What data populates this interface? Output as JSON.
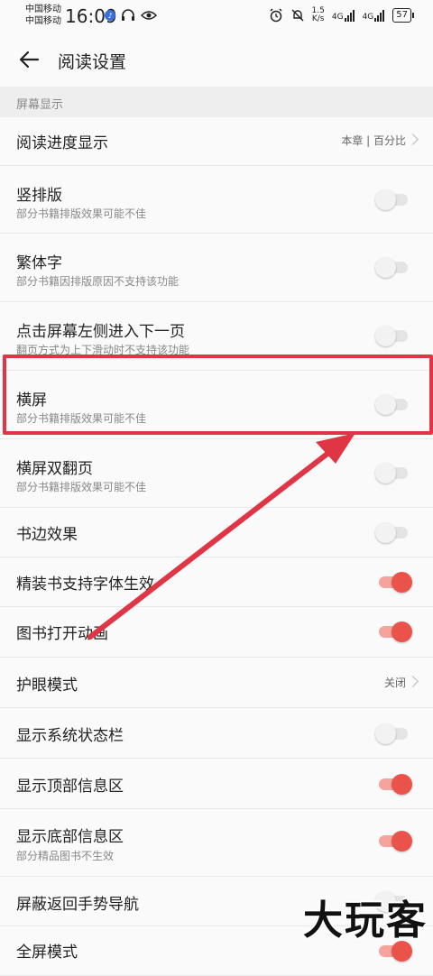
{
  "status_bar": {
    "carrier1": "中国移动",
    "carrier2": "中国移动",
    "time": "16:09",
    "net_speed_value": "1.5",
    "net_speed_unit": "K/s",
    "sig1_label": "4G",
    "sig2_label": "4G",
    "battery": "57"
  },
  "app_bar": {
    "title": "阅读设置"
  },
  "section": {
    "title": "屏幕显示"
  },
  "rows": [
    {
      "title": "阅读进度显示",
      "value": "本章 | 百分比"
    },
    {
      "title": "竖排版",
      "subtitle": "部分书籍排版效果可能不佳",
      "on": false
    },
    {
      "title": "繁体字",
      "subtitle": "部分书籍因排版原因不支持该功能",
      "on": false
    },
    {
      "title": "点击屏幕左侧进入下一页",
      "subtitle": "翻页方式为上下滑动时不支持该功能",
      "on": false
    },
    {
      "title": "横屏",
      "subtitle": "部分书籍排版效果可能不佳",
      "on": false
    },
    {
      "title": "横屏双翻页",
      "subtitle": "部分书籍排版效果可能不佳",
      "on": false
    },
    {
      "title": "书边效果",
      "on": false
    },
    {
      "title": "精装书支持字体生效",
      "on": true
    },
    {
      "title": "图书打开动画",
      "on": true
    },
    {
      "title": "护眼模式",
      "value": "关闭"
    },
    {
      "title": "显示系统状态栏",
      "on": false
    },
    {
      "title": "显示顶部信息区",
      "on": true
    },
    {
      "title": "显示底部信息区",
      "subtitle": "部分精品图书不生效",
      "on": true
    },
    {
      "title": "屏蔽返回手势导航",
      "on": false
    },
    {
      "title": "全屏模式",
      "on": true
    }
  ],
  "watermark": "大玩客",
  "colors": {
    "accent": "#e9534a",
    "highlight": "#e03544"
  }
}
